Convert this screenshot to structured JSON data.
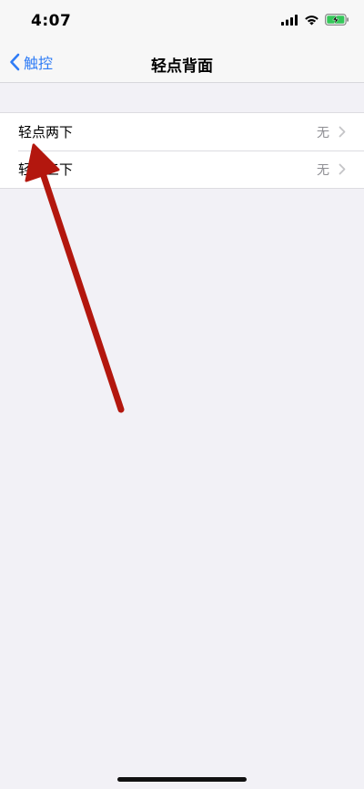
{
  "status_bar": {
    "time": "4:07"
  },
  "nav": {
    "back_label": "触控",
    "title": "轻点背面"
  },
  "rows": [
    {
      "label": "轻点两下",
      "value": "无"
    },
    {
      "label": "轻点三下",
      "value": "无"
    }
  ],
  "colors": {
    "accent": "#2f7cf6",
    "annotation_arrow": "#b3170e",
    "battery": "#34c759",
    "background": "#f2f1f6"
  },
  "icons": {
    "signal": "cellular-signal-icon",
    "wifi": "wifi-icon",
    "battery": "battery-charging-icon",
    "back": "chevron-left-icon",
    "disclosure": "chevron-right-icon"
  }
}
